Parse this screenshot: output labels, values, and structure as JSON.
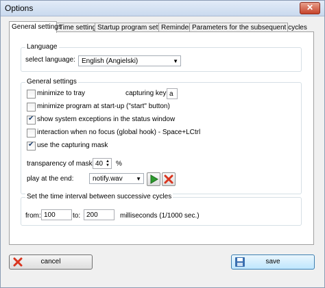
{
  "window": {
    "title": "Options",
    "close_label": "✕"
  },
  "tabs": [
    {
      "label": "General settings"
    },
    {
      "label": "Time settings"
    },
    {
      "label": "Startup program settings"
    },
    {
      "label": "Reminder"
    },
    {
      "label": "Parameters for the subsequent cycles"
    }
  ],
  "language": {
    "group_title": "Language",
    "select_label": "select language:",
    "selected": "English (Angielski)"
  },
  "general": {
    "group_title": "General settings",
    "checkboxes": [
      {
        "label": "minimize to tray",
        "checked": false
      },
      {
        "label": "minimize program at start-up (\"start\" button)",
        "checked": false
      },
      {
        "label": "show system exceptions in the status window",
        "checked": true
      },
      {
        "label": "interaction when no focus (global hook) - Space+LCtrl",
        "checked": false
      },
      {
        "label": "use the capturing mask",
        "checked": true
      }
    ],
    "capturing_key_label": "capturing key:",
    "capturing_key_value": "a",
    "transparency_label": "transparency of masks:",
    "transparency_value": "40",
    "transparency_unit": "%",
    "play_label": "play at the end:",
    "play_file": "notify.wav"
  },
  "interval": {
    "group_title": "Set the time interval between successive cycles",
    "from_label": "from:",
    "from_value": "100",
    "to_label": "to:",
    "to_value": "200",
    "unit": "milliseconds (1/1000 sec.)"
  },
  "buttons": {
    "cancel": "cancel",
    "save": "save"
  },
  "colors": {
    "play_green": "#2e9b2e",
    "stop_red": "#d9351f"
  }
}
